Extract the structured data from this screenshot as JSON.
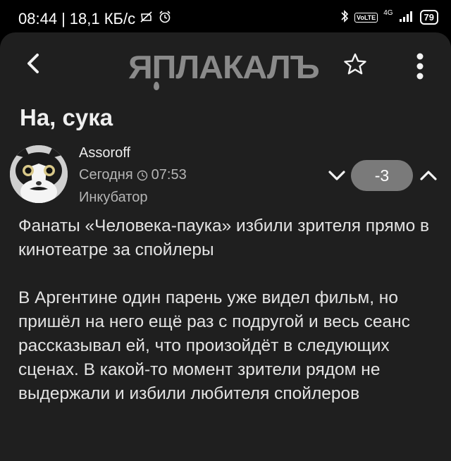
{
  "status_bar": {
    "time": "08:44",
    "speed": "18,1 КБ/с",
    "network_gen": "4G",
    "lte": "VoLTE",
    "battery": "79"
  },
  "app_bar": {
    "logo_text": "ЯПЛАКАЛЪ"
  },
  "post": {
    "title": "На, сука",
    "author": "Assoroff",
    "date": "Сегодня",
    "time": "07:53",
    "rank": "Инкубатор",
    "rating": "-3",
    "paragraphs": [
      "Фанаты «Человека-паука» избили зрителя прямо в кинотеатре за спойлеры",
      "В Аргентине один парень уже видел фильм, но пришёл на него ещё раз с подругой и весь сеанс рассказывал ей, что произойдёт в следующих сценах. В какой-то момент зрители рядом не выдержали и избили любителя спойлеров"
    ]
  }
}
